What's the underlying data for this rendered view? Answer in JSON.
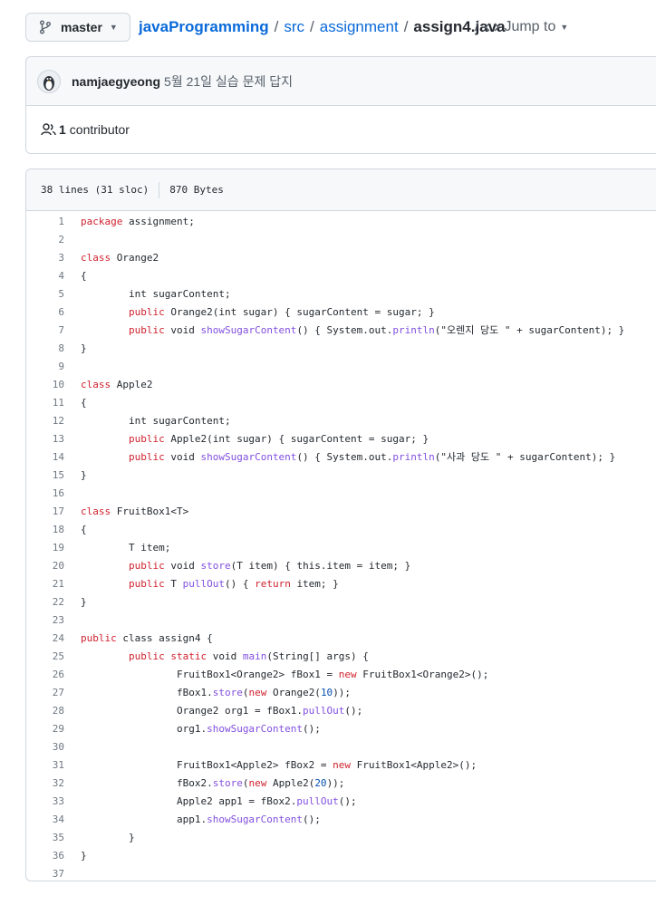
{
  "breadcrumb": {
    "branch": "master",
    "repo": "javaProgramming",
    "path": [
      "src",
      "assignment"
    ],
    "file": "assign4.java",
    "separator": "/",
    "jump_to": "Jump to"
  },
  "commit": {
    "author": "namjaegyeong",
    "message": "5월 21일 실습 문제 답지"
  },
  "contributors": {
    "count": "1",
    "label": "contributor"
  },
  "file_info": {
    "lines": "38 lines (31 sloc)",
    "size": "870 Bytes"
  },
  "code_lines": [
    [
      [
        "kw",
        "package"
      ],
      [
        "",
        "assignment;"
      ]
    ],
    [],
    [
      [
        "kw",
        "class"
      ],
      [
        "",
        "Orange2"
      ]
    ],
    [
      [
        "",
        "{"
      ]
    ],
    [
      [
        "",
        "        int sugarContent;"
      ]
    ],
    [
      [
        "",
        "        "
      ],
      [
        "kw",
        "public"
      ],
      [
        "",
        "Orange2(int sugar) { sugarContent = sugar; }"
      ]
    ],
    [
      [
        "",
        "        "
      ],
      [
        "kw",
        "public"
      ],
      [
        "",
        "void "
      ],
      [
        "fn",
        "showSugarContent"
      ],
      [
        "",
        "() { System.out."
      ],
      [
        "fn",
        "println"
      ],
      [
        "",
        "(\"오렌지 당도 \" + sugarContent); }"
      ]
    ],
    [
      [
        "",
        "}"
      ]
    ],
    [],
    [
      [
        "kw",
        "class"
      ],
      [
        "",
        "Apple2"
      ]
    ],
    [
      [
        "",
        "{"
      ]
    ],
    [
      [
        "",
        "        int sugarContent;"
      ]
    ],
    [
      [
        "",
        "        "
      ],
      [
        "kw",
        "public"
      ],
      [
        "",
        "Apple2(int sugar) { sugarContent = sugar; }"
      ]
    ],
    [
      [
        "",
        "        "
      ],
      [
        "kw",
        "public"
      ],
      [
        "",
        "void "
      ],
      [
        "fn",
        "showSugarContent"
      ],
      [
        "",
        "() { System.out."
      ],
      [
        "fn",
        "println"
      ],
      [
        "",
        "(\"사과 당도 \" + sugarContent); }"
      ]
    ],
    [
      [
        "",
        "}"
      ]
    ],
    [],
    [
      [
        "kw",
        "class"
      ],
      [
        "",
        "FruitBox1<T>"
      ]
    ],
    [
      [
        "",
        "{"
      ]
    ],
    [
      [
        "",
        "        T item;"
      ]
    ],
    [
      [
        "",
        "        "
      ],
      [
        "kw",
        "public"
      ],
      [
        "",
        "void "
      ],
      [
        "fn",
        "store"
      ],
      [
        "",
        "(T item) { this.item = item; }"
      ]
    ],
    [
      [
        "",
        "        "
      ],
      [
        "kw",
        "public"
      ],
      [
        "",
        "T "
      ],
      [
        "fn",
        "pullOut"
      ],
      [
        "",
        "() { "
      ],
      [
        "kw",
        "return"
      ],
      [
        "",
        "item; }"
      ]
    ],
    [
      [
        "",
        "}"
      ]
    ],
    [],
    [
      [
        "kw",
        "public"
      ],
      [
        "",
        "class "
      ],
      [
        "",
        "assign4 {"
      ]
    ],
    [
      [
        "",
        "        "
      ],
      [
        "kw",
        "public static"
      ],
      [
        "",
        "void "
      ],
      [
        "fn",
        "main"
      ],
      [
        "",
        "(String[] args) {"
      ]
    ],
    [
      [
        "",
        "                FruitBox1<Orange2> fBox1 = "
      ],
      [
        "kw",
        "new"
      ],
      [
        "",
        "FruitBox1<Orange2>();"
      ]
    ],
    [
      [
        "",
        "                fBox1."
      ],
      [
        "fn",
        "store"
      ],
      [
        "",
        "("
      ],
      [
        "kw",
        "new"
      ],
      [
        "",
        "Orange2("
      ],
      [
        "nm",
        "10"
      ],
      [
        "",
        "));"
      ]
    ],
    [
      [
        "",
        "                Orange2 org1 = fBox1."
      ],
      [
        "fn",
        "pullOut"
      ],
      [
        "",
        "();"
      ]
    ],
    [
      [
        "",
        "                org1."
      ],
      [
        "fn",
        "showSugarContent"
      ],
      [
        "",
        "();"
      ]
    ],
    [],
    [
      [
        "",
        "                FruitBox1<Apple2> fBox2 = "
      ],
      [
        "kw",
        "new"
      ],
      [
        "",
        "FruitBox1<Apple2>();"
      ]
    ],
    [
      [
        "",
        "                fBox2."
      ],
      [
        "fn",
        "store"
      ],
      [
        "",
        "("
      ],
      [
        "kw",
        "new"
      ],
      [
        "",
        "Apple2("
      ],
      [
        "nm",
        "20"
      ],
      [
        "",
        "));"
      ]
    ],
    [
      [
        "",
        "                Apple2 app1 = fBox2."
      ],
      [
        "fn",
        "pullOut"
      ],
      [
        "",
        "();"
      ]
    ],
    [
      [
        "",
        "                app1."
      ],
      [
        "fn",
        "showSugarContent"
      ],
      [
        "",
        "();"
      ]
    ],
    [
      [
        "",
        "        }"
      ]
    ],
    [
      [
        "",
        "}"
      ]
    ],
    []
  ]
}
